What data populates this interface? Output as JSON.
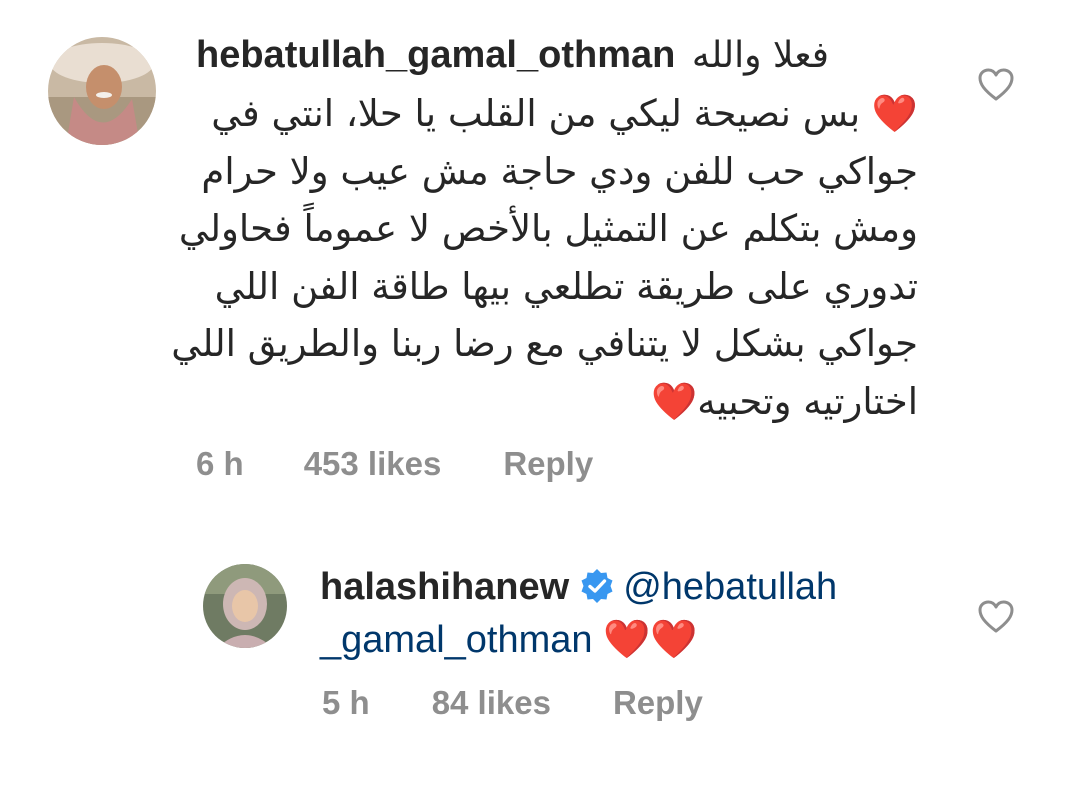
{
  "comments": [
    {
      "username": "hebatullah_gamal_othman",
      "first_line_text": "فعلا والله",
      "body_lines": [
        "❤️ بس نصيحة ليكي من القلب يا حلا، انتي في",
        "جواكي حب للفن ودي حاجة مش عيب ولا حرام",
        "ومش بتكلم عن التمثيل بالأخص لا عموماً فحاولي",
        "تدوري على طريقة تطلعي بيها طاقة الفن اللي",
        "جواكي بشكل لا يتنافي مع رضا ربنا والطريق اللي",
        "اختارتيه وتحبيه❤️"
      ],
      "time": "6 h",
      "likes": "453 likes",
      "reply_label": "Reply",
      "like_icon": "heart-outline-icon"
    },
    {
      "username": "halashihanew",
      "verified": true,
      "verified_icon": "verified-badge-icon",
      "mention_line1": "@hebatullah",
      "mention_line2": "_gamal_othman",
      "emoji": "❤️❤️",
      "time": "5 h",
      "likes": "84 likes",
      "reply_label": "Reply",
      "like_icon": "heart-outline-icon"
    }
  ],
  "colors": {
    "text": "#262626",
    "secondary": "#8e8e8e",
    "mention": "#00376b",
    "verified": "#3897f0",
    "heart": "#e0262d"
  }
}
